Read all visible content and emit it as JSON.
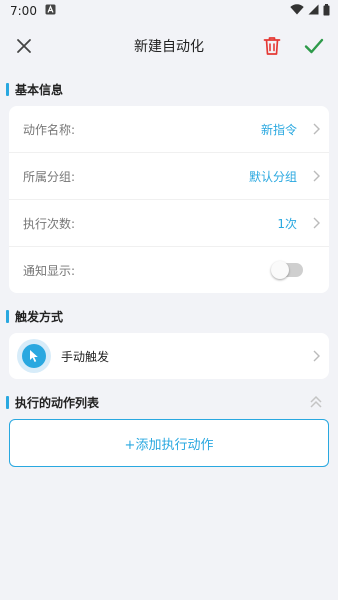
{
  "status": {
    "time": "7:00"
  },
  "header": {
    "title": "新建自动化"
  },
  "basic": {
    "section_title": "基本信息",
    "rows": [
      {
        "label": "动作名称:",
        "value": "新指令"
      },
      {
        "label": "所属分组:",
        "value": "默认分组"
      },
      {
        "label": "执行次数:",
        "value": "1次"
      },
      {
        "label": "通知显示:",
        "toggle": false
      }
    ]
  },
  "trigger": {
    "section_title": "触发方式",
    "item_label": "手动触发"
  },
  "actions": {
    "section_title": "执行的动作列表",
    "add_label": "+添加执行动作"
  },
  "colors": {
    "accent": "#29a8e0",
    "delete": "#e53935",
    "confirm": "#2e9a4a",
    "background": "#f2f3f7"
  }
}
